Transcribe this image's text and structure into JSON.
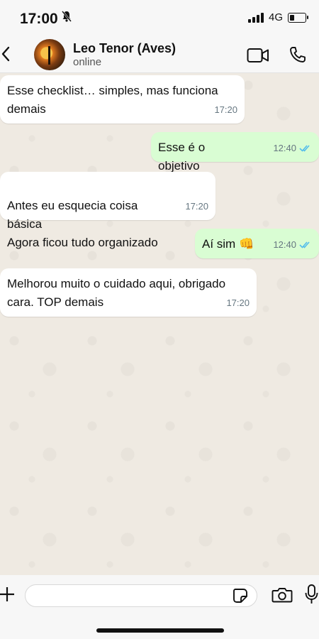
{
  "status": {
    "time": "17:00",
    "network": "4G"
  },
  "header": {
    "name": "Leo Tenor (Aves)",
    "presence": "online"
  },
  "messages": [
    {
      "text": "Esse checklist… simples, mas funciona demais",
      "time": "17:20",
      "direction": "in"
    },
    {
      "text": "Esse é o objetivo",
      "time": "12:40",
      "direction": "out",
      "read": true
    },
    {
      "text": "Antes eu esquecia coisa básica\nAgora ficou tudo organizado",
      "time": "17:20",
      "direction": "in"
    },
    {
      "text": "Aí sim 👊",
      "time": "12:40",
      "direction": "out",
      "read": true
    },
    {
      "text": "Melhorou muito o cuidado aqui, obrigado cara. TOP demais",
      "time": "17:20",
      "direction": "in"
    }
  ],
  "input": {
    "placeholder": ""
  },
  "colors": {
    "incoming": "#ffffff",
    "outgoing": "#d9fdd3",
    "ticks": "#53bdeb",
    "wallpaper": "#efeae2"
  },
  "icons": [
    "bell-slash-icon",
    "signal-icon",
    "battery-icon",
    "back-icon",
    "video-call-icon",
    "phone-icon",
    "plus-icon",
    "sticker-icon",
    "camera-icon",
    "mic-icon"
  ]
}
